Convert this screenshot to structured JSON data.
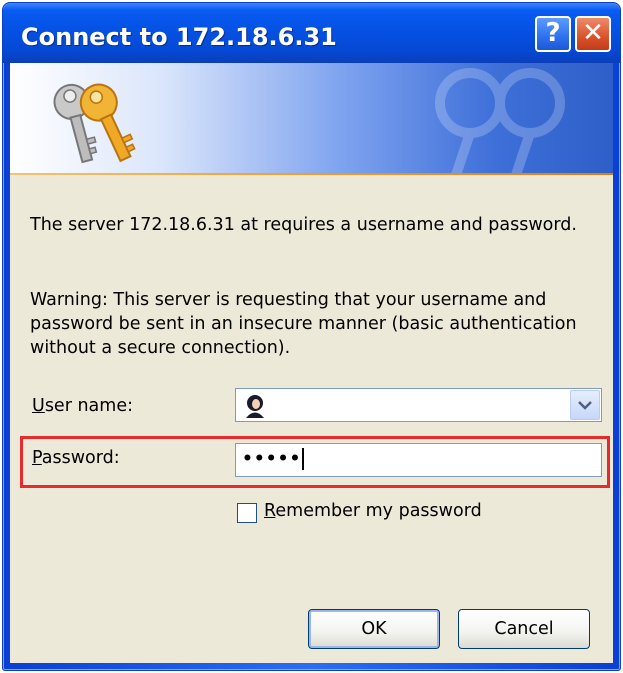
{
  "window": {
    "title": "Connect to 172.18.6.31"
  },
  "titlebar": {
    "help_label": "?",
    "close_label": "✕"
  },
  "message": {
    "line1": "The server 172.18.6.31 at  requires a username and password.",
    "warning": "Warning: This server is requesting that your username and password be sent in an insecure manner (basic authentication without a secure connection)."
  },
  "form": {
    "user_label_u": "U",
    "user_label_rest": "ser name:",
    "username_value": "",
    "password_label_u": "P",
    "password_label_rest": "assword:",
    "password_value": "•••••",
    "remember_u": "R",
    "remember_rest": "emember my password",
    "remember_checked": false
  },
  "buttons": {
    "ok": "OK",
    "cancel": "Cancel"
  },
  "colors": {
    "highlight": "#e52b2b",
    "titlebar": "#0553e6",
    "dialog_bg": "#ece9d8"
  }
}
